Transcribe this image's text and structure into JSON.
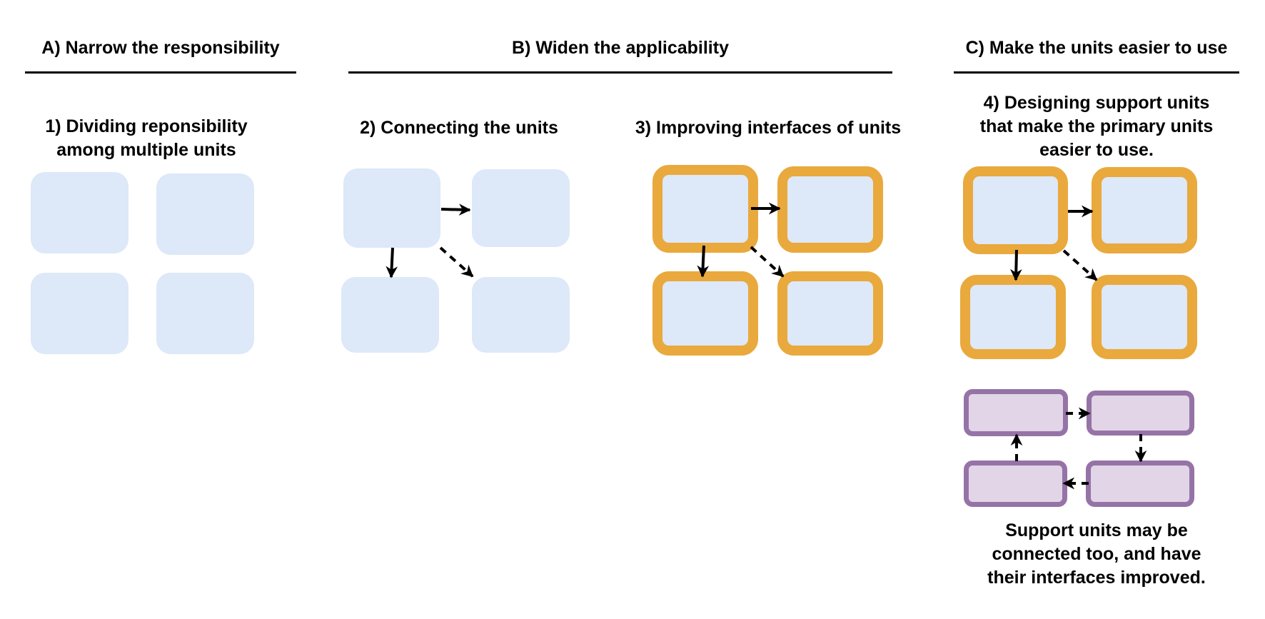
{
  "sections": [
    {
      "id": "A",
      "title": "A) Narrow the responsibility",
      "subsections": [
        {
          "id": "1",
          "caption_lines": [
            "1) Dividing reponsibility",
            "among multiple units"
          ]
        }
      ]
    },
    {
      "id": "B",
      "title": "B) Widen the applicability",
      "subsections": [
        {
          "id": "2",
          "caption_lines": [
            "2) Connecting the units"
          ]
        },
        {
          "id": "3",
          "caption_lines": [
            "3) Improving interfaces of units"
          ]
        }
      ]
    },
    {
      "id": "C",
      "title": "C) Make the units easier to use",
      "subsections": [
        {
          "id": "4",
          "caption_lines": [
            "4) Designing support units",
            "that make the primary units",
            "easier to use."
          ]
        }
      ],
      "footnote_lines": [
        "Support units may be",
        "connected too, and have",
        "their interfaces improved."
      ]
    }
  ],
  "colors": {
    "unit_fill": "#dde8f8",
    "interface_border": "#e9a93c",
    "support_fill": "#e1d5e7",
    "support_border": "#9673a6",
    "arrow": "#000000",
    "rule": "#000000"
  },
  "diagrams": {
    "unit_kinds": [
      "primary-unit",
      "primary-unit-with-interface",
      "support-unit"
    ],
    "connection_kinds": [
      "solid",
      "dashed"
    ],
    "d1": {
      "unit_kind": "primary-unit",
      "units": 4,
      "connections": []
    },
    "d2": {
      "unit_kind": "primary-unit",
      "units": 4,
      "connections": [
        {
          "from": 0,
          "to": 1,
          "style": "solid"
        },
        {
          "from": 0,
          "to": 2,
          "style": "solid"
        },
        {
          "from": 0,
          "to": 3,
          "style": "dashed"
        }
      ]
    },
    "d3": {
      "unit_kind": "primary-unit-with-interface",
      "units": 4,
      "connections": [
        {
          "from": 0,
          "to": 1,
          "style": "solid"
        },
        {
          "from": 0,
          "to": 2,
          "style": "solid"
        },
        {
          "from": 0,
          "to": 3,
          "style": "dashed"
        }
      ]
    },
    "d4": {
      "unit_kind": "primary-unit-with-interface",
      "units": 4,
      "connections": [
        {
          "from": 0,
          "to": 1,
          "style": "solid"
        },
        {
          "from": 0,
          "to": 2,
          "style": "solid"
        },
        {
          "from": 0,
          "to": 3,
          "style": "dashed"
        }
      ]
    },
    "support": {
      "unit_kind": "support-unit",
      "units": 4,
      "connections": [
        {
          "from": 0,
          "to": 1,
          "style": "dashed"
        },
        {
          "from": 1,
          "to": 3,
          "style": "dashed"
        },
        {
          "from": 3,
          "to": 2,
          "style": "dashed"
        },
        {
          "from": 2,
          "to": 0,
          "style": "dashed"
        }
      ]
    }
  }
}
